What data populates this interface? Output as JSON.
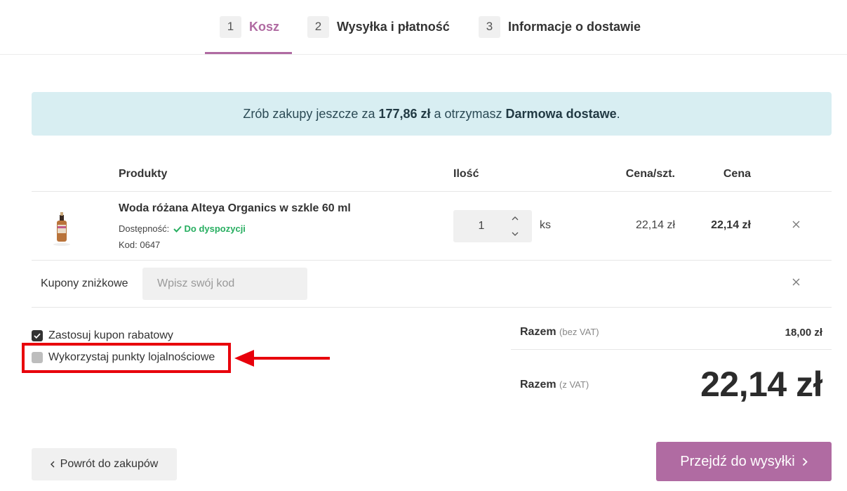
{
  "steps": [
    {
      "num": "1",
      "label": "Kosz"
    },
    {
      "num": "2",
      "label": "Wysyłka i płatność"
    },
    {
      "num": "3",
      "label": "Informacje o dostawie"
    }
  ],
  "banner": {
    "prefix": "Zrób zakupy jeszcze za ",
    "amount": "177,86 zł",
    "middle": " a otrzymasz ",
    "reward": "Darmowa dostawe",
    "suffix": "."
  },
  "table": {
    "headers": {
      "products": "Produkty",
      "qty": "Ilość",
      "unit_price": "Cena/szt.",
      "price": "Cena"
    }
  },
  "product": {
    "name": "Woda różana Alteya Organics w szkle 60 ml",
    "availability_label": "Dostępność:",
    "availability_value": "Do dyspozycji",
    "code": "Kod: 0647",
    "quantity": "1",
    "unit": "ks",
    "unit_price": "22,14 zł",
    "total_price": "22,14 zł"
  },
  "coupon": {
    "label": "Kupony zniżkowe",
    "placeholder": "Wpisz swój kod"
  },
  "options": {
    "apply_coupon": "Zastosuj kupon rabatowy",
    "use_points": "Wykorzystaj punkty lojalnościowe"
  },
  "summary": {
    "net_label": "Razem",
    "net_sub": "(bez VAT)",
    "net_value": "18,00 zł",
    "gross_label": "Razem",
    "gross_sub": "(z VAT)",
    "gross_value": "22,14 zł"
  },
  "buttons": {
    "back": "Powrót do zakupów",
    "next": "Przejdź do wysyłki"
  },
  "colors": {
    "accent": "#b06ba2",
    "banner_bg": "#d8eef2",
    "highlight": "#e8000b",
    "available": "#27ae60"
  }
}
